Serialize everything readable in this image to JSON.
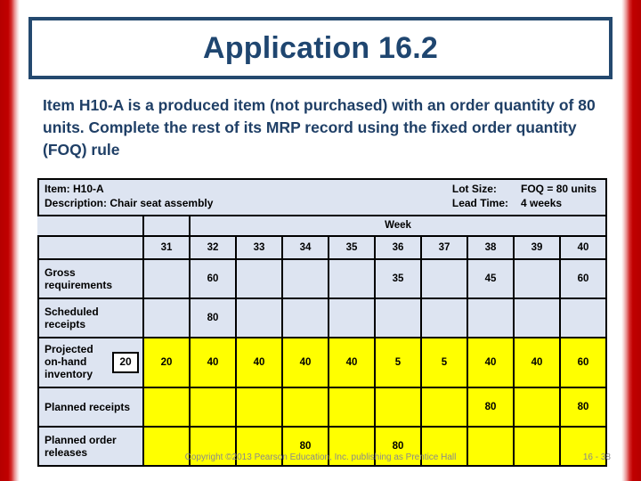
{
  "title": "Application 16.2",
  "lead_text": "Item H10-A is a produced item (not purchased) with an order quantity of 80 units. Complete the rest of its MRP record using the fixed order quantity (FOQ) rule",
  "record_header": {
    "item_label": "Item: H10-A",
    "description_label": "Description: Chair seat assembly",
    "lot_size_label": "Lot Size:",
    "lead_time_label": "Lead Time:",
    "lot_size_value": "FOQ = 80 units",
    "lead_time_value": "4 weeks"
  },
  "table": {
    "week_header": "Week",
    "weeks": [
      "31",
      "32",
      "33",
      "34",
      "35",
      "36",
      "37",
      "38",
      "39",
      "40"
    ],
    "rows": [
      {
        "label": "Gross requirements",
        "highlight": false,
        "values": [
          "",
          "60",
          "",
          "",
          "",
          "35",
          "",
          "45",
          "",
          "60"
        ]
      },
      {
        "label": "Scheduled receipts",
        "highlight": false,
        "values": [
          "",
          "80",
          "",
          "",
          "",
          "",
          "",
          "",
          "",
          ""
        ]
      },
      {
        "label": "Projected on-hand inventory",
        "beginning_inventory": "20",
        "highlight": true,
        "values": [
          "20",
          "40",
          "40",
          "40",
          "40",
          "5",
          "5",
          "40",
          "40",
          "60"
        ]
      },
      {
        "label": "Planned receipts",
        "highlight": true,
        "values": [
          "",
          "",
          "",
          "",
          "",
          "",
          "",
          "80",
          "",
          "80"
        ]
      },
      {
        "label": "Planned order releases",
        "highlight": true,
        "values": [
          "",
          "",
          "",
          "80",
          "",
          "80",
          "",
          "",
          "",
          ""
        ]
      }
    ]
  },
  "footer": {
    "copyright": "Copyright ©2013 Pearson Education, Inc. publishing as Prentice Hall",
    "page": "16 - 38"
  },
  "colors": {
    "accent_navy": "#1f4670",
    "edge_red": "#c00000",
    "cell_blue": "#dde4f1",
    "highlight_yellow": "#ffff00"
  }
}
